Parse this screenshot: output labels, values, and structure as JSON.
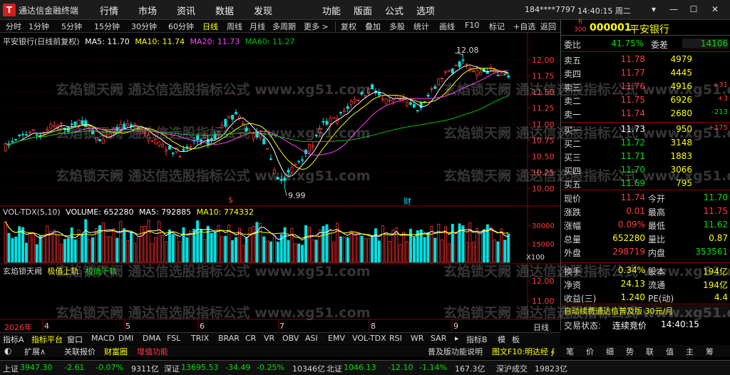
{
  "titlebar": {
    "logo": "T",
    "app_title": "通达信金融终端",
    "menus": [
      "行情",
      "市场",
      "资讯",
      "数据",
      "发现",
      "功能",
      "版面",
      "公式",
      "选项"
    ],
    "account": "184****7797",
    "clock": "14:40:15 周二",
    "win_buttons": [
      "▾",
      "—",
      "☐",
      "✕"
    ]
  },
  "toolbar": {
    "items": [
      "分时",
      "1分钟",
      "5分钟",
      "15分钟",
      "30分钟",
      "60分钟",
      "日线",
      "周线",
      "月线",
      "多周期",
      "更多 >",
      "复权",
      "叠加",
      "多股",
      "统计",
      "画线",
      "F10",
      "标记",
      "+自选",
      "返回"
    ],
    "active": "日线"
  },
  "chart": {
    "main_legend": {
      "title": "平安银行(日线前复权)",
      "ma5": "MA5: 11.70",
      "ma10": "MA10: 11.74",
      "ma20": "MA20: 11.73",
      "ma60": "MA60: 11.27"
    },
    "high_label": "12.08",
    "low_label": "9.99",
    "event_marks": [
      "$",
      "财"
    ],
    "vol_legend": {
      "title": "VOL-TDX(5,10)",
      "volume": "VOLUME: 652280",
      "ma5": "MA5: 792885",
      "ma10": "MA10: 774332"
    },
    "vol_unit": "X100",
    "ind_legend": {
      "title": "玄焰锁天阙",
      "up": "极值上轨",
      "down": "极值下轨"
    },
    "x_labels": [
      "2026年",
      "4",
      "5",
      "6",
      "7",
      "8",
      "9"
    ],
    "colors": {
      "up": "#ff3232",
      "down": "#00e0e0",
      "ma5": "#ffffff",
      "ma10": "#ffff00",
      "ma20": "#ff40ff",
      "ma60": "#00c000"
    }
  },
  "chart_data": {
    "type": "candlestick",
    "title": "平安银行(日线前复权)",
    "price_ylim": [
      9.85,
      12.2
    ],
    "price_ticks": [
      "12.00",
      "11.75",
      "11.50",
      "11.25",
      "11.00",
      "10.75",
      "10.50",
      "10.25",
      "10.00"
    ],
    "vol_ticks": [
      "30000",
      "15000"
    ],
    "ind_ticks": [
      "12.00",
      "11.00"
    ],
    "highest": 12.08,
    "lowest": 9.99,
    "ma_last": {
      "MA5": 11.7,
      "MA10": 11.74,
      "MA20": 11.73,
      "MA60": 11.27
    },
    "volume_last": 652280,
    "volume_ma5": 792885,
    "volume_ma10": 774332,
    "months": [
      "2026年",
      "4",
      "5",
      "6",
      "7",
      "8",
      "9"
    ]
  },
  "rpanel": {
    "badge_top": "R",
    "badge_num": "300",
    "code": "000001",
    "name": "平安银行",
    "ratio_label": "委比",
    "ratio_value": "41.75%",
    "diff_label": "委差",
    "diff_value": "14106",
    "asks": [
      {
        "label": "卖五",
        "price": "11.78",
        "vol": "4979",
        "chg": ""
      },
      {
        "label": "卖四",
        "price": "11.77",
        "vol": "4445",
        "chg": ""
      },
      {
        "label": "卖三",
        "price": "11.76",
        "vol": "4916",
        "chg": "+31"
      },
      {
        "label": "卖二",
        "price": "11.75",
        "vol": "6926",
        "chg": "+3"
      },
      {
        "label": "卖一",
        "price": "11.74",
        "vol": "2680",
        "chg": "-213"
      }
    ],
    "bids": [
      {
        "label": "买一",
        "price": "11.73",
        "vol": "950",
        "chg": "+175"
      },
      {
        "label": "买二",
        "price": "11.72",
        "vol": "3148",
        "chg": ""
      },
      {
        "label": "买三",
        "price": "11.71",
        "vol": "1883",
        "chg": ""
      },
      {
        "label": "买四",
        "price": "11.70",
        "vol": "3066",
        "chg": ""
      },
      {
        "label": "买五",
        "price": "11.69",
        "vol": "795",
        "chg": ""
      }
    ],
    "stats": [
      {
        "l1": "现价",
        "v1": "11.74",
        "l2": "今开",
        "v2": "11.70"
      },
      {
        "l1": "涨跌",
        "v1": "0.01",
        "l2": "最高",
        "v2": "11.75"
      },
      {
        "l1": "涨幅",
        "v1": "0.09%",
        "l2": "最低",
        "v2": "11.62"
      },
      {
        "l1": "总量",
        "v1": "652280",
        "l2": "量比",
        "v2": "0.87"
      },
      {
        "l1": "外盘",
        "v1": "298719",
        "l2": "内盘",
        "v2": "353561"
      }
    ],
    "stats2": [
      {
        "l1": "换手",
        "v1": "0.34%",
        "l2": "股本",
        "v2": "194亿"
      },
      {
        "l1": "净资",
        "v1": "24.13",
        "l2": "流通",
        "v2": "194亿"
      },
      {
        "l1": "收益(三)",
        "v1": "1.240",
        "l2": "PE(动)",
        "v2": "4.4"
      }
    ],
    "promo": "自动续费通达信普及版 30元/月",
    "trade_status_label": "交易状态:",
    "trade_status_value": "连续竞价",
    "trade_status_time": "14:40:15"
  },
  "tabs": {
    "items": [
      "指标A",
      "指标平台",
      "窗口",
      "MACD",
      "DMI",
      "DMA",
      "FSL",
      "TRIX",
      "BRAR",
      "CR",
      "VR",
      "OBV",
      "ASI",
      "EMV",
      "VOL-TDX",
      "RSI",
      "WR",
      "SAR",
      "▸",
      "指标B",
      "模",
      "板"
    ],
    "active": "指标平台",
    "right_label": "日线"
  },
  "subtabs": {
    "items": [
      "扩展∧",
      "关联报价",
      "财富圈",
      "增值功能"
    ],
    "notice": "普及版功能说明",
    "notice2": "图文F10:明达经 ∮",
    "right": [
      "笔",
      "价",
      "细",
      "势",
      "联",
      "值",
      "主",
      "筹"
    ]
  },
  "status": {
    "items": [
      {
        "name": "上证",
        "value": "3947.30",
        "chg": "-2.61",
        "pct": "-0.07%",
        "amt": "9311亿"
      },
      {
        "name": "深证",
        "value": "13695.53",
        "chg": "-34.49",
        "pct": "-0.25%",
        "amt": "10346亿"
      },
      {
        "name": "北证",
        "value": "1046.13",
        "chg": "-12.10",
        "pct": "-1.14%",
        "amt": "167.3亿"
      }
    ],
    "right_label": "深沪成交",
    "right_value": "19823亿"
  },
  "watermark": "玄焰锁天阙 通达信选股指标公式 www.xg51.com"
}
